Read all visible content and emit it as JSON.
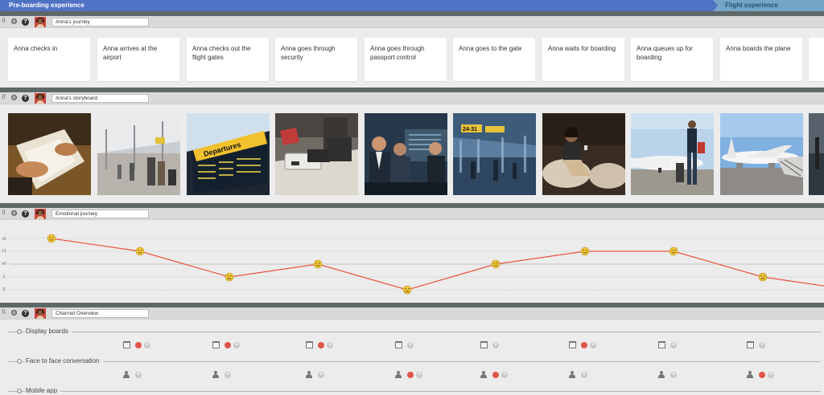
{
  "stages": {
    "pre_boarding": "Pre-boarding experience",
    "flight": "Flight experience"
  },
  "lanes": {
    "journey_title": "Anna's journey",
    "storyboard_title": "Anna's storyboard",
    "emotion_title": "Emotional journey",
    "channel_title": "Channel Overview"
  },
  "steps": [
    "Anna checks in",
    "Anna arrives at the airport",
    "Anna checks out the flight gates",
    "Anna goes through security",
    "Anna goes through passport control",
    "Anna goes to the gate",
    "Anna waits for boarding",
    "Anna queues up for boarding",
    "Anna boards the plane",
    ""
  ],
  "storyboard": [
    {
      "scene": "hands-paperwork"
    },
    {
      "scene": "terminal-crowd"
    },
    {
      "scene": "departures-board",
      "sign_text": "Departures"
    },
    {
      "scene": "security-tray"
    },
    {
      "scene": "passport-control"
    },
    {
      "scene": "terminal-gate",
      "sign_text": "24-31"
    },
    {
      "scene": "waiting-lounge"
    },
    {
      "scene": "woman-plane"
    },
    {
      "scene": "aircraft-stand"
    },
    {
      "scene": "edge"
    }
  ],
  "emotion": {
    "y_ticks": [
      "+2",
      "+1",
      "+0",
      "-1",
      "-2"
    ],
    "levels": [
      2,
      1,
      -1,
      0,
      -2,
      0,
      1,
      1,
      -1,
      -1.7
    ],
    "line_color": "#e9553f",
    "happy_face_color": "#f0c93a",
    "sad_face_color": "#f0c93a"
  },
  "channels": [
    {
      "name": "Display boards",
      "icon": "calendar-icon",
      "active": [
        true,
        true,
        true,
        false,
        false,
        true,
        false,
        false,
        false
      ]
    },
    {
      "name": "Face to face conversation",
      "icon": "person-icon",
      "active": [
        false,
        false,
        false,
        true,
        true,
        false,
        false,
        true,
        true
      ]
    },
    {
      "name": "Mobile app",
      "icon": "phone-icon",
      "active": []
    }
  ]
}
